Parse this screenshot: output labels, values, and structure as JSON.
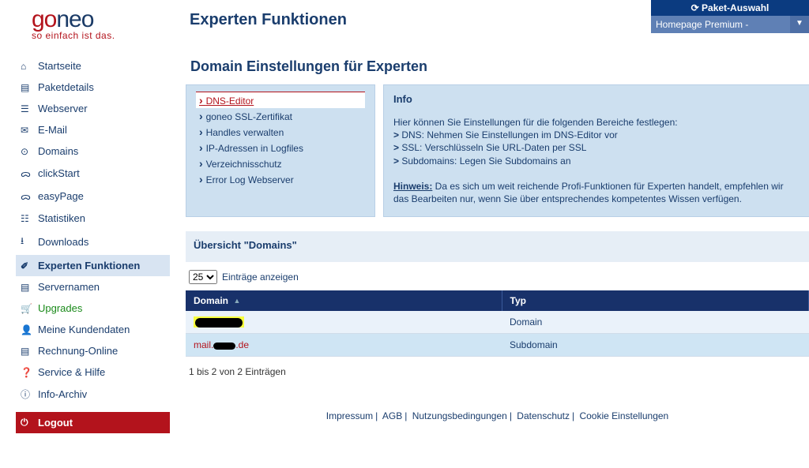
{
  "logo": {
    "go": "go",
    "neo": "neo",
    "tagline": "so einfach ist das."
  },
  "page_title": "Experten Funktionen",
  "paket": {
    "head": "Paket-Auswahl",
    "current": "Homepage Premium - ",
    "drop": "▼"
  },
  "sidebar": {
    "items": [
      {
        "icon": "⌂",
        "label": "Startseite"
      },
      {
        "icon": "▤",
        "label": "Paketdetails"
      },
      {
        "icon": "☰",
        "label": "Webserver"
      },
      {
        "icon": "✉",
        "label": "E-Mail"
      },
      {
        "icon": "⊙",
        "label": "Domains"
      },
      {
        "icon": "ᯅ",
        "label": "clickStart"
      },
      {
        "icon": "ᯅ",
        "label": "easyPage"
      },
      {
        "icon": "☷",
        "label": "Statistiken"
      },
      {
        "icon": "⭳",
        "label": "Downloads"
      },
      {
        "icon": "✐",
        "label": "Experten Funktionen"
      },
      {
        "icon": "▤",
        "label": "Servernamen"
      },
      {
        "icon": "🛒",
        "label": "Upgrades"
      },
      {
        "icon": "👤",
        "label": "Meine Kundendaten"
      },
      {
        "icon": "▤",
        "label": "Rechnung-Online"
      },
      {
        "icon": "❓",
        "label": "Service & Hilfe"
      },
      {
        "icon": "ⓘ",
        "label": "Info-Archiv"
      },
      {
        "icon": "⏻",
        "label": "Logout"
      }
    ]
  },
  "section_heading": "Domain Einstellungen für Experten",
  "sub_links": [
    "DNS-Editor",
    "goneo SSL-Zertifikat",
    "Handles verwalten",
    "IP-Adressen in Logfiles",
    "Verzeichnisschutz",
    "Error Log Webserver"
  ],
  "info": {
    "title": "Info",
    "intro": "Hier können Sie Einstellungen für die folgenden Bereiche festlegen:",
    "lines": [
      "DNS: Nehmen Sie Einstellungen im DNS-Editor vor",
      "SSL: Verschlüsseln Sie URL-Daten per SSL",
      "Subdomains: Legen Sie Subdomains an"
    ],
    "hint_label": "Hinweis:",
    "hint_text": " Da es sich um weit reichende Profi-Funktionen für Experten handelt, empfehlen wir das Bearbeiten nur, wenn Sie über entsprechendes kompetentes Wissen verfügen."
  },
  "table": {
    "title": "Übersicht \"Domains\"",
    "page_size": "25",
    "page_size_label": "Einträge anzeigen",
    "cols": {
      "domain": "Domain",
      "typ": "Typ"
    },
    "rows": [
      {
        "domain_masked": true,
        "domain": "",
        "typ": "Domain"
      },
      {
        "domain_masked": false,
        "domain_prefix": "mail.",
        "domain_suffix": ".de",
        "typ": "Subdomain"
      }
    ],
    "footer": "1 bis 2 von 2 Einträgen"
  },
  "footer": {
    "links": [
      "Impressum",
      "AGB",
      "Nutzungsbedingungen",
      "Datenschutz",
      "Cookie Einstellungen"
    ]
  }
}
